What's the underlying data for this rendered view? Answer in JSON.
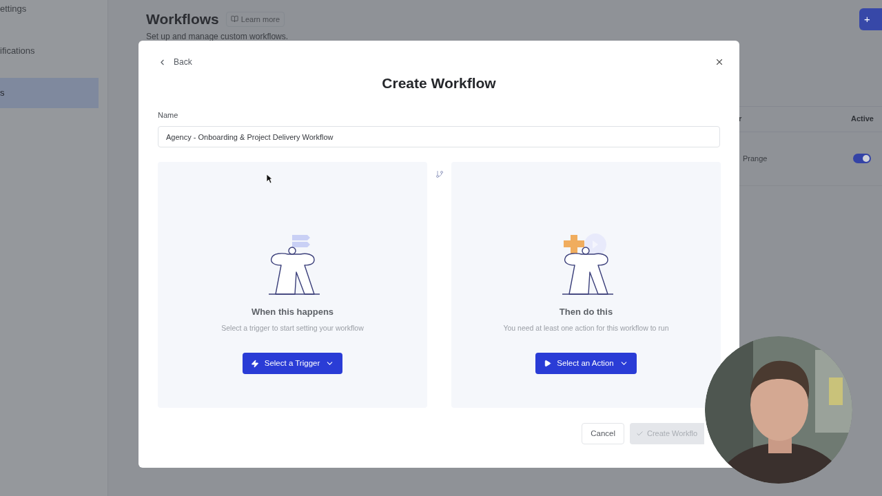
{
  "sidebar": {
    "items": [
      {
        "label": "ettings",
        "selected": false
      },
      {
        "label": "ifications",
        "selected": false
      },
      {
        "label": "s",
        "selected": true
      }
    ]
  },
  "page": {
    "title": "Workflows",
    "learn_more": "Learn more",
    "subtitle": "Set up and manage custom workflows.",
    "add_button": "+"
  },
  "table": {
    "columns": [
      "r",
      "Active"
    ],
    "rows": [
      {
        "column_1": "Prange",
        "active": true
      }
    ]
  },
  "modal": {
    "back": "Back",
    "title": "Create Workflow",
    "name_label": "Name",
    "name_value": "Agency - Onboarding & Project Delivery Workflow",
    "panels": [
      {
        "kind": "trigger",
        "heading": "When this happens",
        "text": "Select a trigger to start setting your workflow",
        "button": "Select a Trigger"
      },
      {
        "kind": "action",
        "heading": "Then do this",
        "text": "You need at least one action for this workflow to run",
        "button": "Select an Action"
      }
    ],
    "cancel": "Cancel",
    "create": "Create Workflo",
    "create_disabled": true
  }
}
